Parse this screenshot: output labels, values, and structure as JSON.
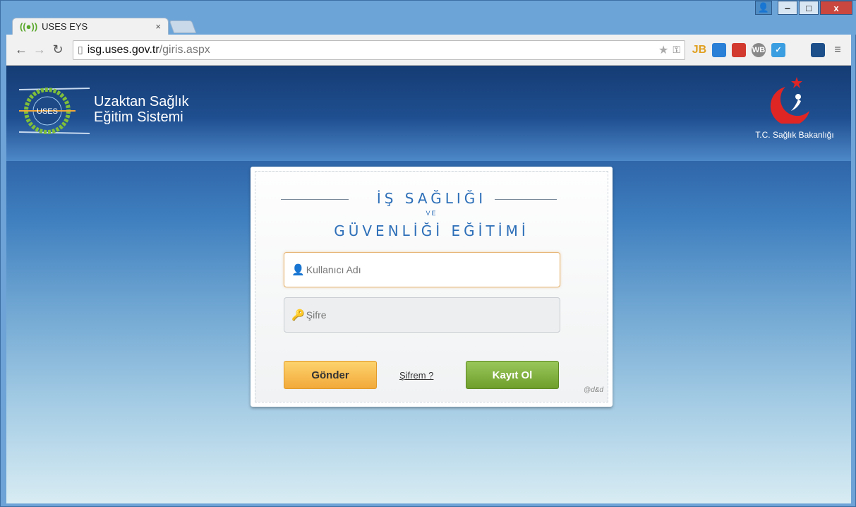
{
  "browser": {
    "tab_title": "USES EYS",
    "tab_close": "×",
    "url_host": "isg.uses.gov.tr",
    "url_path": "/giris.aspx",
    "extensions": [
      "JB",
      "",
      "",
      "WB",
      "✓",
      "",
      "",
      "≡"
    ]
  },
  "window": {
    "minimize": "‒",
    "maximize": "□",
    "close": "x"
  },
  "header": {
    "site_title_line1": "Uzaktan Sağlık",
    "site_title_line2": "Eğitim Sistemi",
    "logo_text": "USES",
    "ministry_label": "T.C. Sağlık Bakanlığı"
  },
  "login": {
    "heading_line1": "İŞ SAĞLIĞI",
    "heading_ve": "VE",
    "heading_line2": "GÜVENLİĞİ EĞİTİMİ",
    "username_placeholder": "Kullanıcı Adı",
    "password_placeholder": "Şifre",
    "submit_label": "Gönder",
    "forgot_label": "Şifrem ?",
    "register_label": "Kayıt Ol",
    "credit": "@d&d"
  },
  "colors": {
    "heading": "#2d6fb8",
    "submit": "#f2a93a",
    "register": "#6f9e2c"
  }
}
